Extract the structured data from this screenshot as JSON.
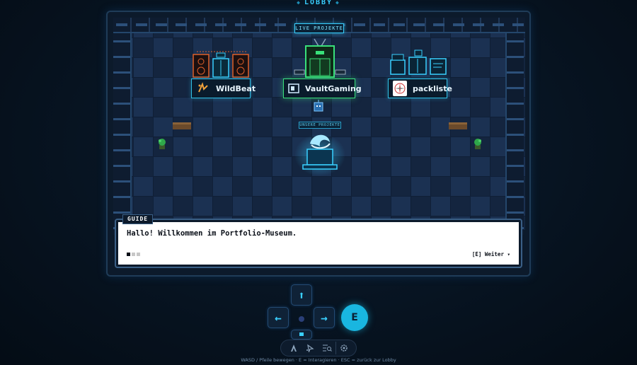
{
  "room": {
    "title": "LOBBY"
  },
  "signs": {
    "live": "LIVE PROJEKTE",
    "own": "UNSERE PROJEKTE"
  },
  "exhibits": [
    {
      "name": "WildBeat"
    },
    {
      "name": "VaultGaming"
    },
    {
      "name": "packliste"
    }
  ],
  "dialog": {
    "speaker": "GUIDE",
    "text": "Hallo! Willkommen im Portfolio-Museum.",
    "continue_label": "[E] Weiter ▾",
    "pages_total": 3,
    "page_current": 1
  },
  "controls": {
    "up": "⬆",
    "left": "←",
    "right": "→",
    "interact": "E"
  },
  "toolbar": {
    "icons": [
      "accessibility-icon",
      "sparkle-cursor-icon",
      "search-list-icon",
      "settings-icon"
    ]
  },
  "hint": "WASD / Pfeile bewegen · E = Interagieren · ESC = zurück zur Lobby",
  "colors": {
    "accent": "#39d0ff",
    "green": "#39e07a",
    "background": "#06111d"
  }
}
